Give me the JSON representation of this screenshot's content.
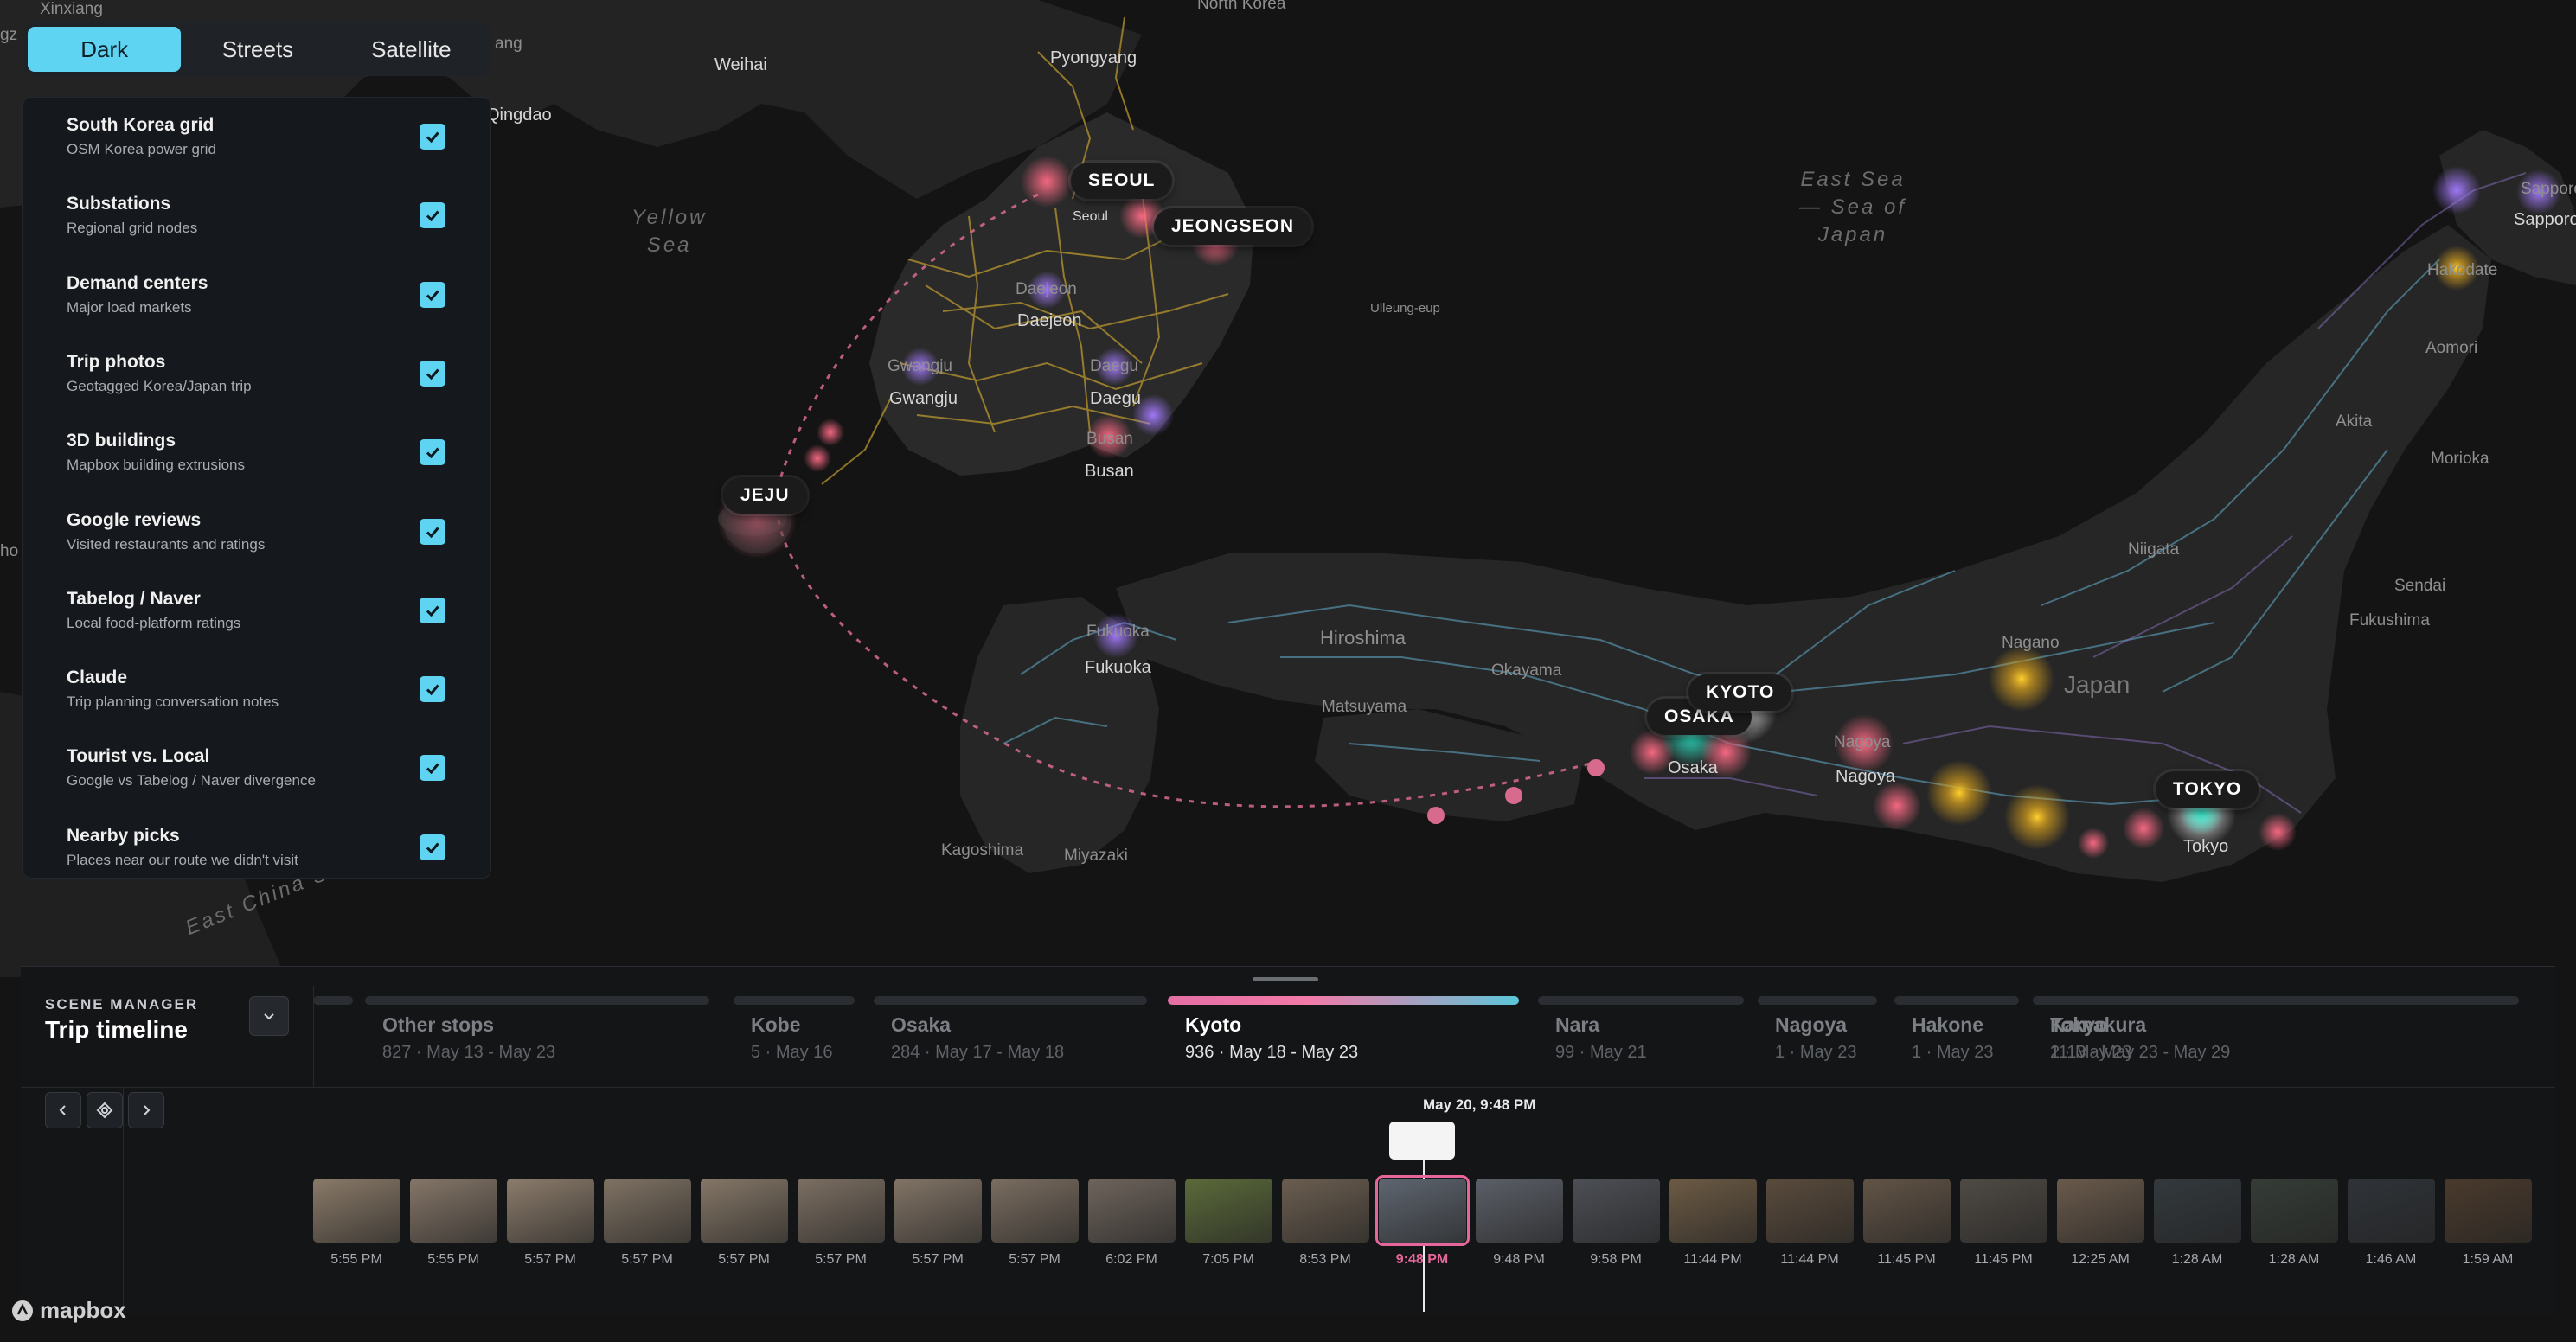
{
  "map": {
    "places": [
      {
        "name": "Xinxiang"
      },
      {
        "name": "Weihai"
      },
      {
        "name": "Qingdao"
      },
      {
        "name": "Pyongyang"
      },
      {
        "name": "North Korea"
      },
      {
        "name": "Seoul"
      },
      {
        "name": "Daejeon"
      },
      {
        "name": "Daejeon"
      },
      {
        "name": "Gwangju"
      },
      {
        "name": "Gwangju"
      },
      {
        "name": "Daegu"
      },
      {
        "name": "Daegu"
      },
      {
        "name": "Busan"
      },
      {
        "name": "Busan"
      },
      {
        "name": "Ulleung-eup"
      },
      {
        "name": "Sapporo"
      },
      {
        "name": "Sapporo"
      },
      {
        "name": "Hakodate"
      },
      {
        "name": "Aomori"
      },
      {
        "name": "Akita"
      },
      {
        "name": "Morioka"
      },
      {
        "name": "Niigata"
      },
      {
        "name": "Sendai"
      },
      {
        "name": "Fukushima"
      },
      {
        "name": "Nagano"
      },
      {
        "name": "Japan"
      },
      {
        "name": "Hiroshima"
      },
      {
        "name": "Okayama"
      },
      {
        "name": "Matsuyama"
      },
      {
        "name": "Fukuoka"
      },
      {
        "name": "Fukuoka"
      },
      {
        "name": "Kagoshima"
      },
      {
        "name": "Miyazaki"
      },
      {
        "name": "Osaka"
      },
      {
        "name": "Nagoya"
      },
      {
        "name": "Nagoya"
      },
      {
        "name": "Tokyo"
      },
      {
        "name": "ho"
      },
      {
        "name": "gz"
      },
      {
        "name": "ang"
      }
    ],
    "seas": [
      "Yellow\nSea",
      "East Sea\n— Sea of\nJapan",
      "East China Sea"
    ],
    "callouts": [
      "SEOUL",
      "JEONGSEON",
      "JEJU",
      "OSAKA",
      "KYOTO",
      "TOKYO"
    ]
  },
  "style_switcher": {
    "options": [
      "Dark",
      "Streets",
      "Satellite"
    ],
    "active": "Dark",
    "active_color": "#5fd3f2"
  },
  "layers": [
    {
      "title": "South Korea grid",
      "subtitle": "OSM Korea power grid",
      "checked": true
    },
    {
      "title": "Substations",
      "subtitle": "Regional grid nodes",
      "checked": true
    },
    {
      "title": "Demand centers",
      "subtitle": "Major load markets",
      "checked": true
    },
    {
      "title": "Trip photos",
      "subtitle": "Geotagged Korea/Japan trip",
      "checked": true
    },
    {
      "title": "3D buildings",
      "subtitle": "Mapbox building extrusions",
      "checked": true
    },
    {
      "title": "Google reviews",
      "subtitle": "Visited restaurants and ratings",
      "checked": true
    },
    {
      "title": "Tabelog / Naver",
      "subtitle": "Local food-platform ratings",
      "checked": true
    },
    {
      "title": "Claude",
      "subtitle": "Trip planning conversation notes",
      "checked": true
    },
    {
      "title": "Tourist vs. Local",
      "subtitle": "Google vs Tabelog / Naver divergence",
      "checked": true
    },
    {
      "title": "Nearby picks",
      "subtitle": "Places near our route we didn't visit",
      "checked": true
    }
  ],
  "scene_manager": {
    "kicker": "SCENE MANAGER",
    "title": "Trip timeline"
  },
  "segments": [
    {
      "name": "Other stops",
      "meta": "827 · May 13 - May 23",
      "active": false
    },
    {
      "name": "Kobe",
      "meta": "5 · May 16",
      "active": false
    },
    {
      "name": "Osaka",
      "meta": "284 · May 17 - May 18",
      "active": false
    },
    {
      "name": "Kyoto",
      "meta": "936 · May 18 - May 23",
      "active": true
    },
    {
      "name": "Nara",
      "meta": "99 · May 21",
      "active": false
    },
    {
      "name": "Nagoya",
      "meta": "1 · May 23",
      "active": false
    },
    {
      "name": "Hakone",
      "meta": "1 · May 23",
      "active": false
    },
    {
      "name": "Kamakura",
      "meta": "2 · May 23",
      "active": false
    },
    {
      "name": "Tokyo",
      "meta": "1113 · May 23 - May 29",
      "active": false
    }
  ],
  "playhead": {
    "label": "May 20, 9:48 PM"
  },
  "photos": [
    {
      "time": "5:55 PM",
      "color": "#8a7a68"
    },
    {
      "time": "5:55 PM",
      "color": "#857668"
    },
    {
      "time": "5:57 PM",
      "color": "#8c7c6b"
    },
    {
      "time": "5:57 PM",
      "color": "#7f7263"
    },
    {
      "time": "5:57 PM",
      "color": "#857767"
    },
    {
      "time": "5:57 PM",
      "color": "#7c6f62"
    },
    {
      "time": "5:57 PM",
      "color": "#827466"
    },
    {
      "time": "5:57 PM",
      "color": "#7a6d60"
    },
    {
      "time": "6:02 PM",
      "color": "#6e645c"
    },
    {
      "time": "7:05 PM",
      "color": "#5b6a3a"
    },
    {
      "time": "8:53 PM",
      "color": "#6b5e50"
    },
    {
      "time": "9:48 PM",
      "color": "#5f6670",
      "selected": true
    },
    {
      "time": "9:48 PM",
      "color": "#5b5f67"
    },
    {
      "time": "9:58 PM",
      "color": "#4c4f55"
    },
    {
      "time": "11:44 PM",
      "color": "#6c5a44"
    },
    {
      "time": "11:44 PM",
      "color": "#5a4b3c"
    },
    {
      "time": "11:45 PM",
      "color": "#625446"
    },
    {
      "time": "11:45 PM",
      "color": "#4f4a44"
    },
    {
      "time": "12:25 AM",
      "color": "#6a5a4b"
    },
    {
      "time": "1:28 AM",
      "color": "#33393d"
    },
    {
      "time": "1:28 AM",
      "color": "#353c36"
    },
    {
      "time": "1:46 AM",
      "color": "#2f3338"
    },
    {
      "time": "1:59 AM",
      "color": "#4a3a2c"
    }
  ],
  "attribution": {
    "logo": "mapbox",
    "icon": "mapbox-logo-icon"
  },
  "colors": {
    "accent": "#5fd3f2",
    "highlight": "#e4669a",
    "korea_grid": "#c9a53a",
    "japan_grid": "#6fb7c9"
  }
}
